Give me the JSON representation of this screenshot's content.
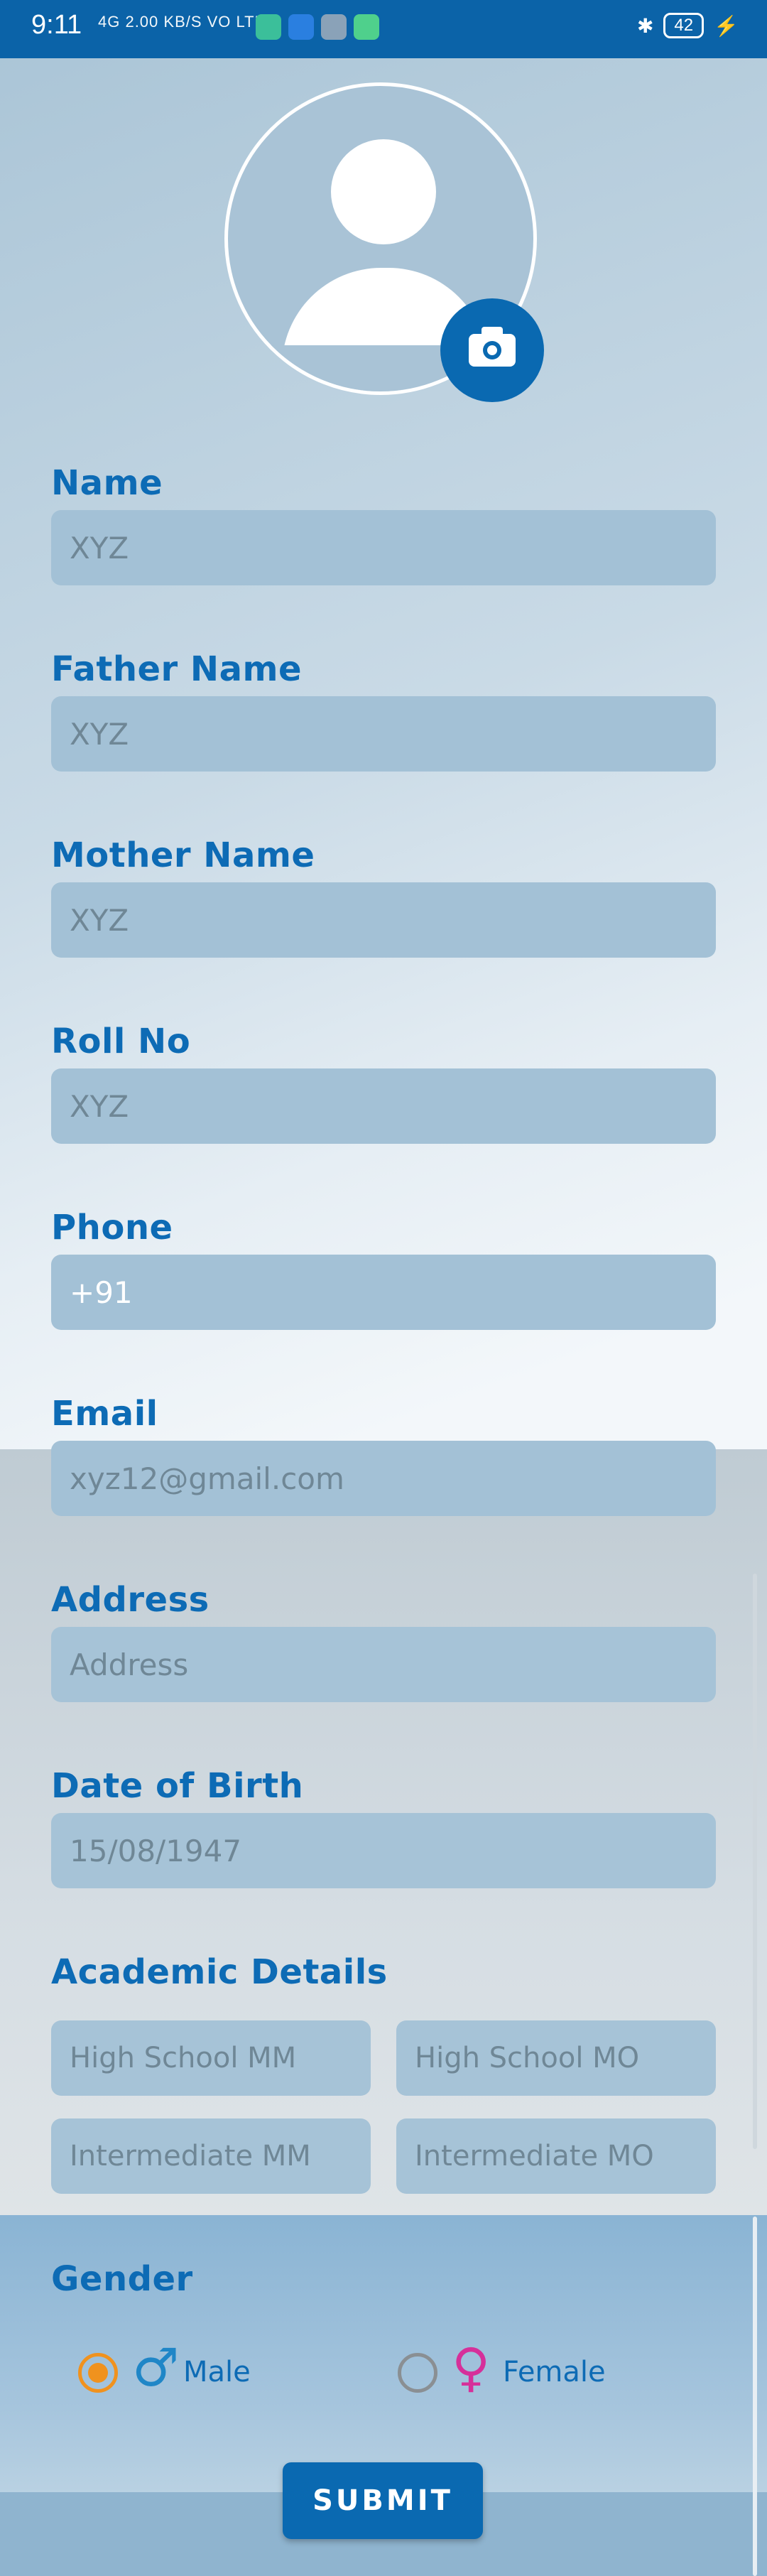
{
  "status_bar": {
    "time": "9:11",
    "network": "4G  2.00 KB/S  VO LTE",
    "battery": "42"
  },
  "form": {
    "name": {
      "label": "Name",
      "placeholder": "XYZ"
    },
    "father_name": {
      "label": "Father Name",
      "placeholder": "XYZ"
    },
    "mother_name": {
      "label": "Mother Name",
      "placeholder": "XYZ"
    },
    "roll_no": {
      "label": "Roll No",
      "placeholder": "XYZ"
    },
    "phone": {
      "label": "Phone",
      "value": "+91"
    },
    "email": {
      "label": "Email",
      "placeholder": "xyz12@gmail.com"
    },
    "address": {
      "label": "Address",
      "placeholder": "Address"
    },
    "dob": {
      "label": "Date of Birth",
      "placeholder": "15/08/1947"
    },
    "academic": {
      "label": "Academic Details",
      "high_school_mm": "High School MM",
      "high_school_mo": "High School MO",
      "intermediate_mm": "Intermediate MM",
      "intermediate_mo": "Intermediate MO"
    },
    "gender": {
      "label": "Gender",
      "male": "Male",
      "female": "Female",
      "selected": "Male"
    },
    "submit_label": "SUBMIT"
  },
  "colors": {
    "accent": "#0d6bb5",
    "field_bg": "#a3c1d6",
    "radio_selected": "#f0921e",
    "male_icon": "#1f86c7",
    "female_icon": "#d6309a"
  },
  "icons": [
    "avatar-placeholder",
    "camera-icon",
    "male-symbol-icon",
    "female-symbol-icon"
  ]
}
